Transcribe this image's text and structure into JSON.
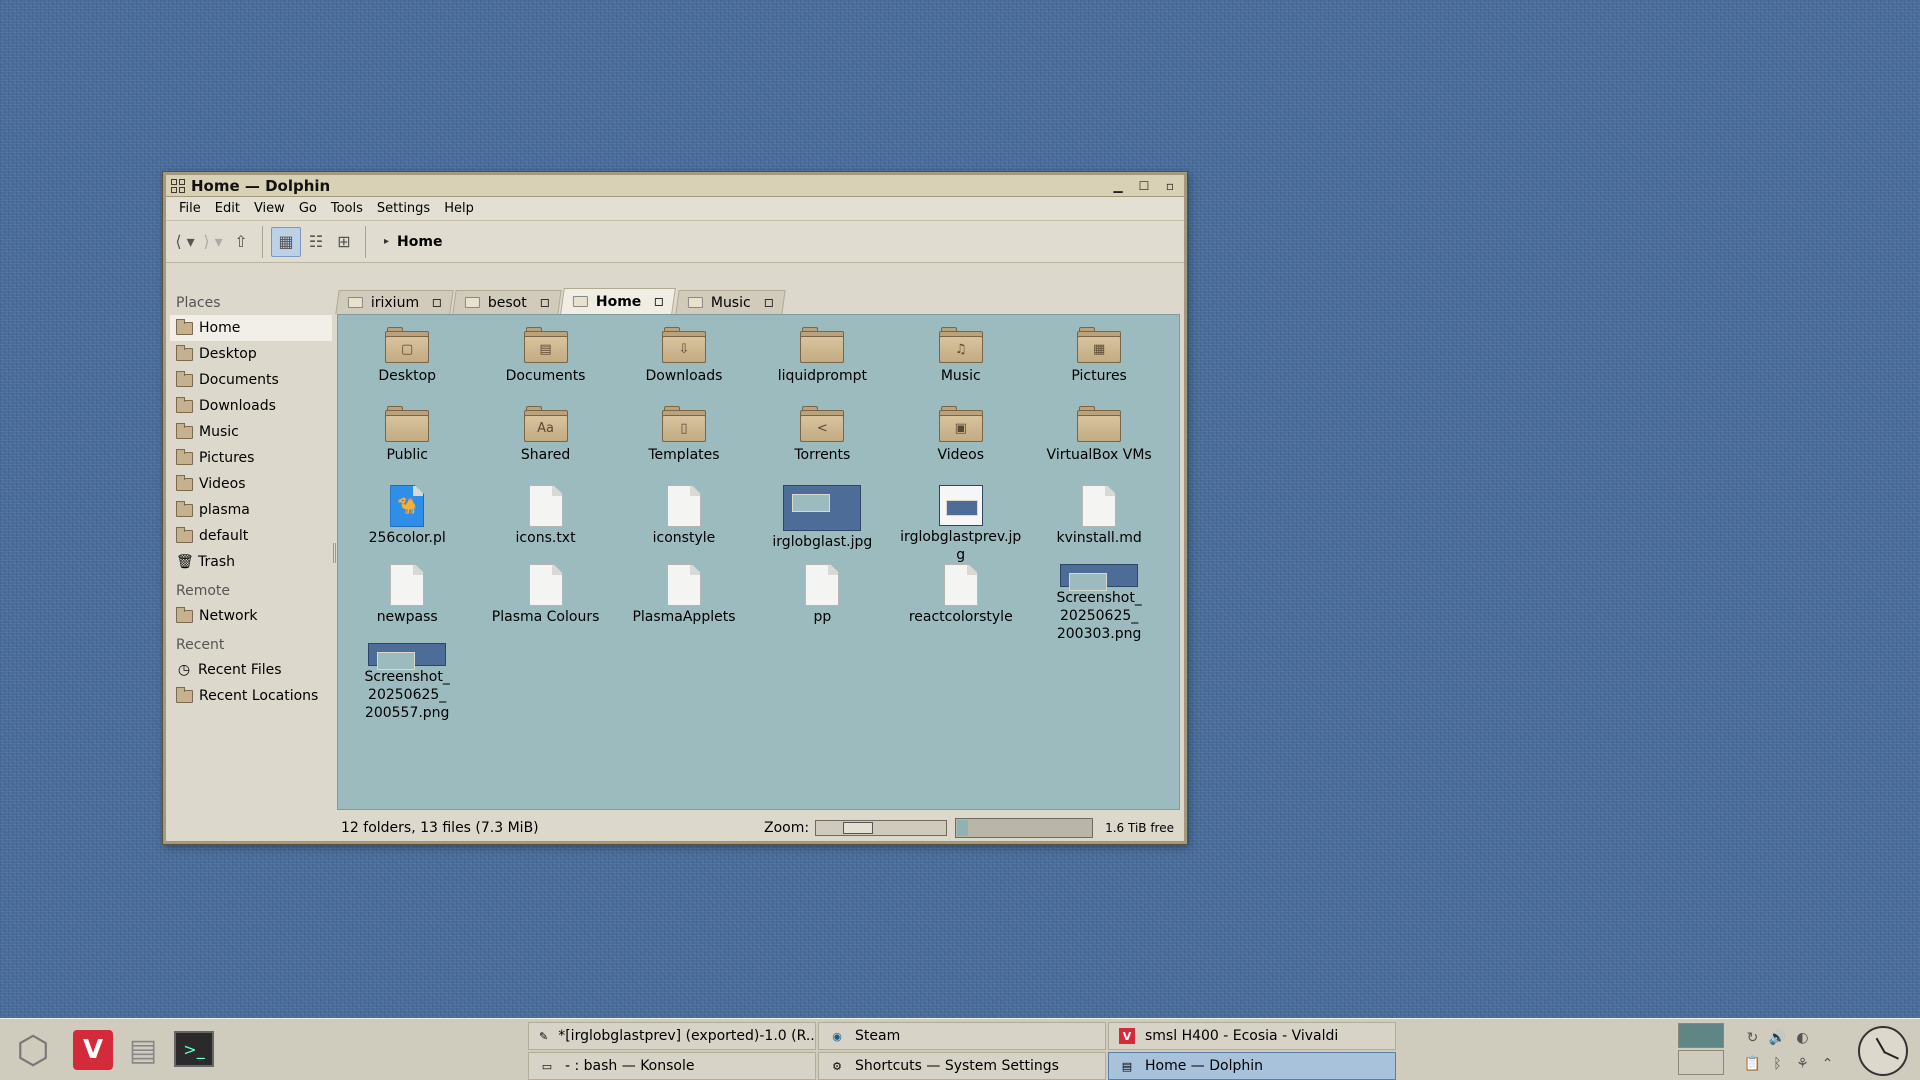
{
  "window": {
    "title": "Home — Dolphin",
    "controls": [
      "minimize",
      "maximize",
      "close"
    ]
  },
  "menubar": [
    "File",
    "Edit",
    "View",
    "Go",
    "Tools",
    "Settings",
    "Help"
  ],
  "toolbar": {
    "breadcrumb": "Home",
    "view_mode": "icons"
  },
  "places": {
    "sections": [
      {
        "heading": "Places",
        "items": [
          {
            "label": "Home",
            "icon": "home-folder-icon",
            "active": true
          },
          {
            "label": "Desktop",
            "icon": "desktop-folder-icon"
          },
          {
            "label": "Documents",
            "icon": "documents-folder-icon"
          },
          {
            "label": "Downloads",
            "icon": "downloads-folder-icon"
          },
          {
            "label": "Music",
            "icon": "music-folder-icon"
          },
          {
            "label": "Pictures",
            "icon": "pictures-folder-icon"
          },
          {
            "label": "Videos",
            "icon": "videos-folder-icon"
          },
          {
            "label": "plasma",
            "icon": "folder-icon"
          },
          {
            "label": "default",
            "icon": "folder-icon"
          },
          {
            "label": "Trash",
            "icon": "trash-icon"
          }
        ]
      },
      {
        "heading": "Remote",
        "items": [
          {
            "label": "Network",
            "icon": "network-folder-icon"
          }
        ]
      },
      {
        "heading": "Recent",
        "items": [
          {
            "label": "Recent Files",
            "icon": "clock-icon"
          },
          {
            "label": "Recent Locations",
            "icon": "folder-icon"
          }
        ]
      }
    ]
  },
  "tabs": [
    {
      "label": "irixium",
      "active": false
    },
    {
      "label": "besot",
      "active": false
    },
    {
      "label": "Home",
      "active": true
    },
    {
      "label": "Music",
      "active": false
    }
  ],
  "files": [
    {
      "name": "Desktop",
      "kind": "folder",
      "glyph": "▢"
    },
    {
      "name": "Documents",
      "kind": "folder",
      "glyph": "▤"
    },
    {
      "name": "Downloads",
      "kind": "folder",
      "glyph": "⇩"
    },
    {
      "name": "liquidprompt",
      "kind": "folder",
      "glyph": ""
    },
    {
      "name": "Music",
      "kind": "folder",
      "glyph": "♫"
    },
    {
      "name": "Pictures",
      "kind": "folder",
      "glyph": "▦"
    },
    {
      "name": "Public",
      "kind": "folder",
      "glyph": ""
    },
    {
      "name": "Shared",
      "kind": "folder",
      "glyph": "Aa"
    },
    {
      "name": "Templates",
      "kind": "folder",
      "glyph": "▯"
    },
    {
      "name": "Torrents",
      "kind": "folder",
      "glyph": "<"
    },
    {
      "name": "Videos",
      "kind": "folder",
      "glyph": "▣"
    },
    {
      "name": "VirtualBox VMs",
      "kind": "folder",
      "glyph": ""
    },
    {
      "name": "256color.pl",
      "kind": "script"
    },
    {
      "name": "icons.txt",
      "kind": "doc"
    },
    {
      "name": "iconstyle",
      "kind": "doc"
    },
    {
      "name": "irglobglast.jpg",
      "kind": "image"
    },
    {
      "name": "irglobglastprev.jpg",
      "kind": "image-light"
    },
    {
      "name": "kvinstall.md",
      "kind": "doc"
    },
    {
      "name": "newpass",
      "kind": "doc"
    },
    {
      "name": "Plasma Colours",
      "kind": "doc"
    },
    {
      "name": "PlasmaApplets",
      "kind": "doc"
    },
    {
      "name": "pp",
      "kind": "doc"
    },
    {
      "name": "reactcolorstyle",
      "kind": "doc"
    },
    {
      "name": "Screenshot_ 20250625_ 200303.png",
      "kind": "image"
    },
    {
      "name": "Screenshot_ 20250625_ 200557.png",
      "kind": "image"
    }
  ],
  "status": {
    "info": "12 folders, 13 files (7.3 MiB)",
    "zoom_label": "Zoom:",
    "zoom_level": 0.3,
    "free_space": "1.6 TiB free",
    "used_fraction": 0.08
  },
  "taskbar": {
    "launchers": [
      {
        "name": "application-menu-icon",
        "glyph": "⬡"
      },
      {
        "name": "vivaldi-launcher-icon",
        "glyph": "V"
      },
      {
        "name": "file-manager-launcher-icon",
        "glyph": "▤"
      },
      {
        "name": "terminal-launcher-icon",
        "glyph": ">_"
      }
    ],
    "tasks": [
      {
        "label": "*[irglobglastprev] (exported)-1.0 (R...",
        "icon": "gimp-icon",
        "glyph": "✎",
        "active": false
      },
      {
        "label": "Steam",
        "icon": "steam-icon",
        "glyph": "◉",
        "active": false
      },
      {
        "label": "smsl H400 - Ecosia - Vivaldi",
        "icon": "vivaldi-icon",
        "glyph": "V",
        "active": false
      },
      {
        "label": "- : bash — Konsole",
        "icon": "konsole-icon",
        "glyph": "▭",
        "active": false
      },
      {
        "label": "Shortcuts — System Settings",
        "icon": "settings-icon",
        "glyph": "⚙",
        "active": false
      },
      {
        "label": "Home — Dolphin",
        "icon": "dolphin-icon",
        "glyph": "▤",
        "active": true
      }
    ],
    "tray": [
      {
        "name": "update-icon",
        "glyph": "↻"
      },
      {
        "name": "volume-icon",
        "glyph": "🔊"
      },
      {
        "name": "night-color-icon",
        "glyph": "◐"
      },
      {
        "name": "spacer",
        "glyph": ""
      },
      {
        "name": "clipboard-icon",
        "glyph": "📋"
      },
      {
        "name": "bluetooth-icon",
        "glyph": "ᛒ"
      },
      {
        "name": "network-icon",
        "glyph": "⚘"
      },
      {
        "name": "expand-tray-icon",
        "glyph": "⌃"
      }
    ]
  }
}
